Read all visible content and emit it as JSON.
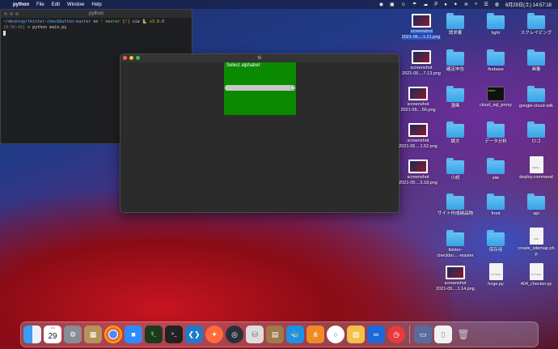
{
  "menubar": {
    "app": "python",
    "items": [
      "File",
      "Edit",
      "Window",
      "Help"
    ],
    "clock": "6月29日(土) 14:57:18"
  },
  "terminal": {
    "title": "python",
    "line1_path": "~/desktop/tkinter-checkbutton-master",
    "line1_on": "on",
    "line1_branch": "master",
    "line1_status": "[!]",
    "line1_via": "via",
    "line1_version": "v3.9.0",
    "line2_time": "[8:56:42]",
    "line2_cmd": "> python main.py"
  },
  "tk": {
    "title": "tk",
    "label": "Select alphabet"
  },
  "desktop": {
    "screenshots": [
      {
        "name": "screenshot\n2021-05....1.21.png"
      },
      {
        "name": "screenshot\n2021-05....7.13.png"
      },
      {
        "name": "screenshot\n2021-05....56.png"
      },
      {
        "name": "screenshot\n2021-05....1.52.png"
      },
      {
        "name": "screenshot\n2021-05....3.18.png"
      }
    ],
    "col1": [
      "請求書",
      "確定申告",
      "漫画",
      "論文",
      "小説",
      "サイト作成納品物",
      "tkinter-\ncheckbu....-master",
      "screenshot\n2021-05....1.14.png"
    ],
    "col2": [
      "light",
      "firebase",
      "cloud_sql_proxy",
      "データ分析",
      "site",
      "front",
      "保存用",
      "hoge.py"
    ],
    "col3": [
      "スクレイピング",
      "画像",
      "google-cloud-sdk",
      "ロゴ",
      "deploy.command",
      "api",
      "create_sitemap.ph\np",
      "404_checker.py"
    ]
  },
  "dock": {
    "calendar_month": "JUN",
    "calendar_day": "29",
    "apps": [
      "finder",
      "calendar",
      "system-preferences",
      "keychain",
      "chrome",
      "zoom",
      "terminal-green",
      "terminal",
      "vscode",
      "safari",
      "quicktime",
      "sequel",
      "archive",
      "docker",
      "sourcetree",
      "figma",
      "preview",
      "infinity",
      "clock"
    ]
  }
}
